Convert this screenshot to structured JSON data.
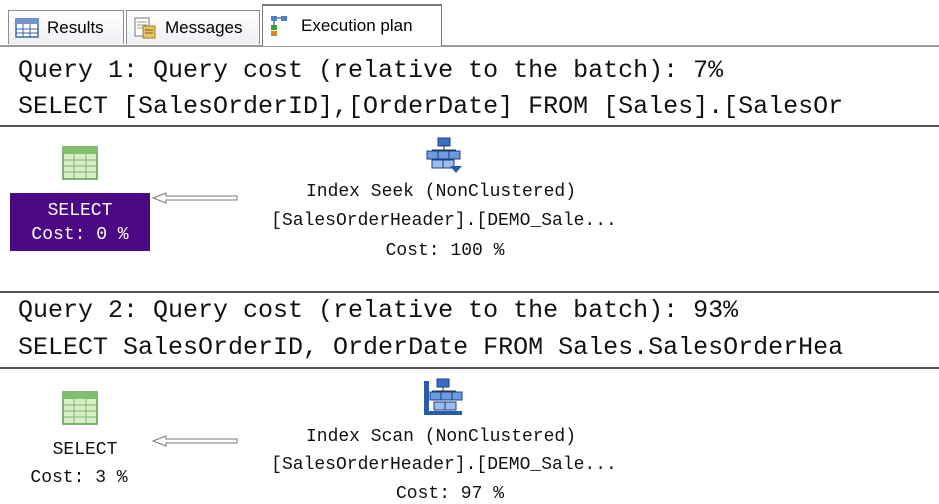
{
  "tabs": [
    {
      "label": "Results",
      "icon": "results-grid-icon",
      "active": false
    },
    {
      "label": "Messages",
      "icon": "messages-icon",
      "active": false
    },
    {
      "label": "Execution plan",
      "icon": "execution-plan-icon",
      "active": true
    }
  ],
  "queries": [
    {
      "header": "Query 1: Query cost (relative to the batch): 7%",
      "sql": "SELECT [SalesOrderID],[OrderDate] FROM [Sales].[SalesOr",
      "select_node": {
        "label": "SELECT",
        "cost": "Cost: 0 %",
        "selected": true
      },
      "operator_node": {
        "icon": "index-seek-icon",
        "name": "Index Seek (NonClustered)",
        "object": "[SalesOrderHeader].[DEMO_Sale...",
        "cost": "Cost: 100 %"
      }
    },
    {
      "header": "Query 2: Query cost (relative to the batch): 93%",
      "sql": "SELECT SalesOrderID, OrderDate FROM Sales.SalesOrderHea",
      "select_node": {
        "label": "SELECT",
        "cost": "Cost: 3 %",
        "selected": false
      },
      "operator_node": {
        "icon": "index-scan-icon",
        "name": "Index Scan (NonClustered)",
        "object": "[SalesOrderHeader].[DEMO_Sale...",
        "cost": "Cost: 97 %"
      }
    }
  ],
  "colors": {
    "selected_node_bg": "#4b0a84",
    "selected_node_text": "#ffffff",
    "separator": "#555555"
  }
}
